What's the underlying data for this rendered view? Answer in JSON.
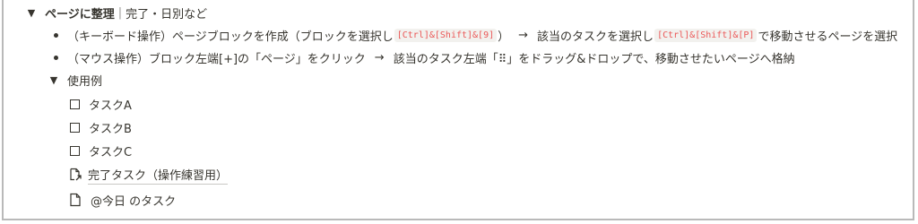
{
  "header": {
    "toggle_glyph": "▼",
    "title": "ページに整理",
    "separator": "|",
    "subtitle": "完了・日別など"
  },
  "bullets": [
    {
      "p1": "（キーボード操作）ページブロックを作成（ブロックを選択し",
      "code1": "[Ctrl]&[Shift]&[9]",
      "p2": "）",
      "arrow": "→",
      "p3": "該当のタスクを選択し",
      "code2": "[Ctrl]&[Shift]&[P]",
      "p4": "で移動させるページを選択"
    },
    {
      "p1": "（マウス操作）ブロック左端[+]の「ページ」をクリック",
      "arrow": "→",
      "p2": "該当のタスク左端「⠿」をドラッグ&ドロップで、移動させたいページへ格納"
    }
  ],
  "example": {
    "toggle_glyph": "▼",
    "label": "使用例",
    "tasks": [
      "タスクA",
      "タスクB",
      "タスクC"
    ],
    "pages": [
      {
        "icon": "page-link-icon",
        "label": "完了タスク（操作練習用）"
      },
      {
        "icon": "page-icon",
        "label": "@今日 のタスク"
      }
    ]
  }
}
